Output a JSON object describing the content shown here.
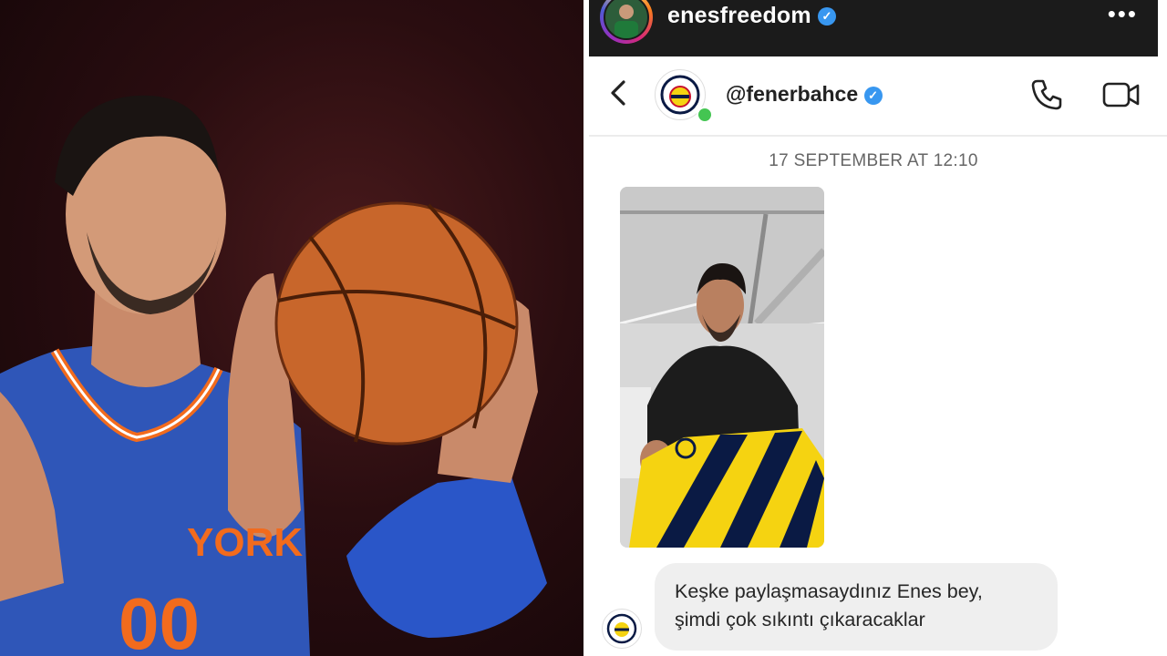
{
  "instagram_bar": {
    "username": "enesfreedom",
    "verified_mark": "✓",
    "more_icon": "•••"
  },
  "chat_header": {
    "contact_name": "@fenerbahce",
    "verified_mark": "✓",
    "online": true,
    "icons": [
      "back-arrow-icon",
      "phone-call-icon",
      "video-call-icon"
    ]
  },
  "chat": {
    "timestamp": "17 SEPTEMBER AT 12:10",
    "message_line1": "Keşke paylaşmasaydınız Enes bey,",
    "message_line2": "şimdi çok sıkıntı çıkaracaklar"
  },
  "colors": {
    "verified": "#3897f0",
    "online": "#44c552",
    "bubble": "#efefef",
    "fenerbahce_yellow": "#f5d311",
    "fenerbahce_navy": "#0a1a44",
    "knicks_blue": "#2f56b8",
    "knicks_orange": "#f26b1d"
  }
}
